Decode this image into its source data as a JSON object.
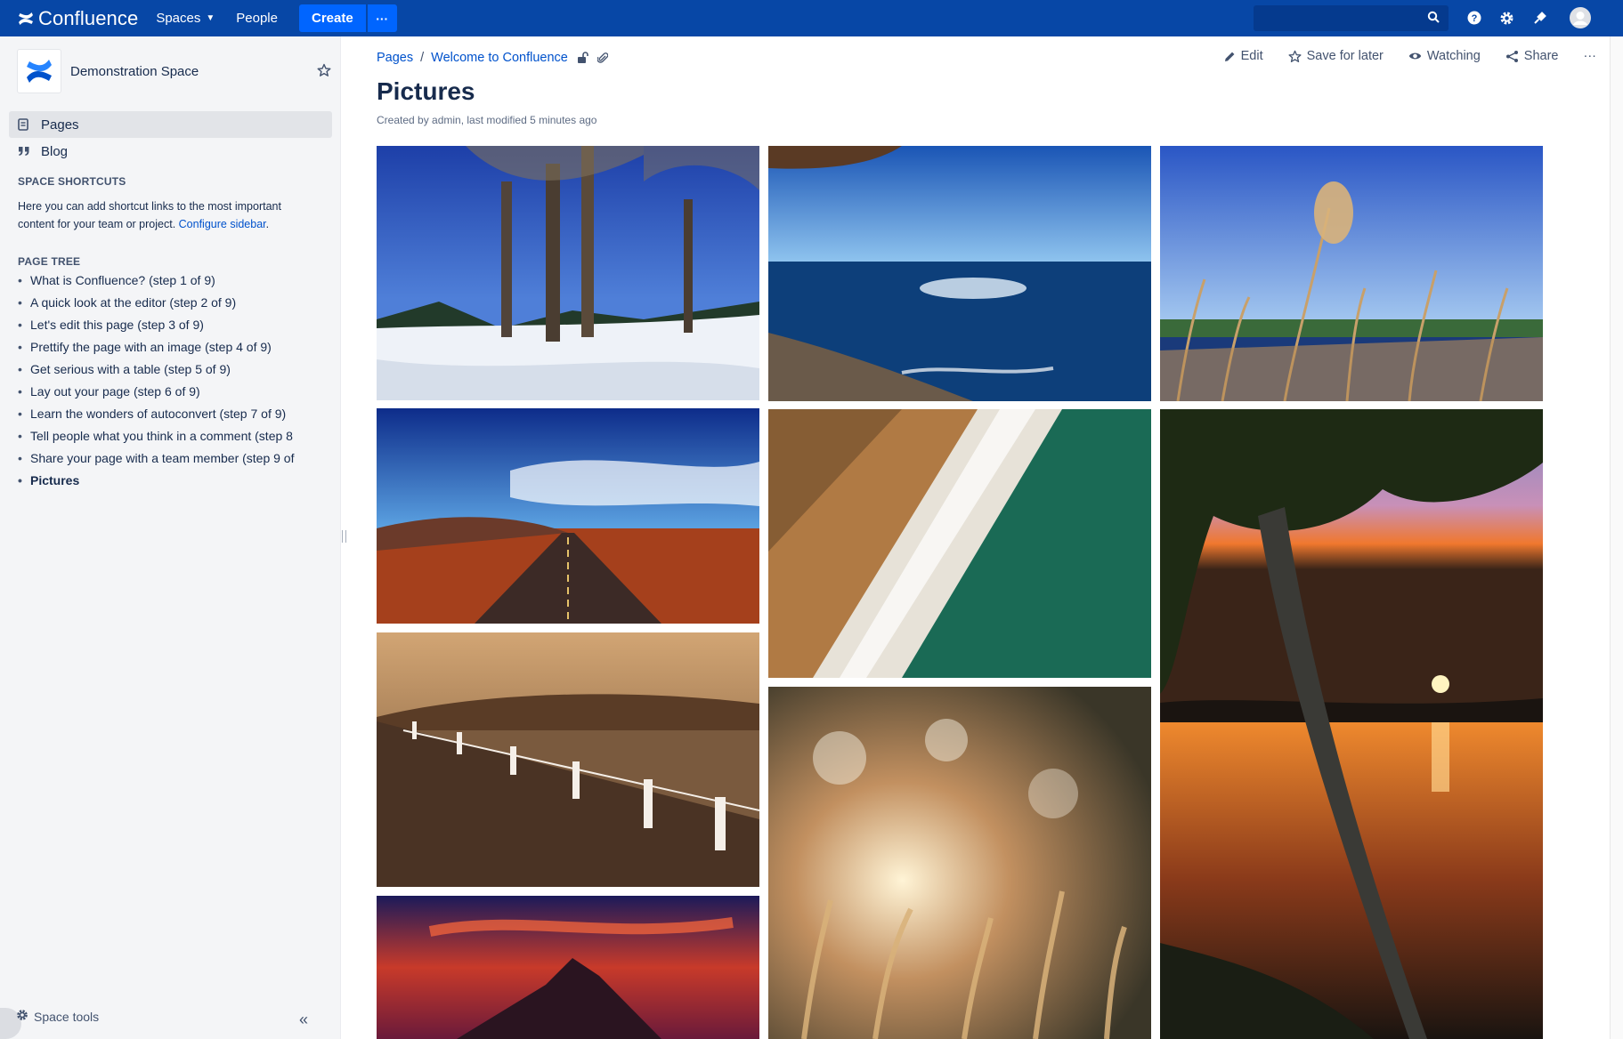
{
  "header": {
    "brand": "Confluence",
    "nav": {
      "spaces": "Spaces",
      "people": "People"
    },
    "create_label": "Create",
    "more_label": "···",
    "search": {
      "placeholder": ""
    },
    "icons": [
      "help-icon",
      "settings-icon",
      "notifications-icon",
      "avatar"
    ]
  },
  "sidebar": {
    "space_name": "Demonstration Space",
    "nav_items": [
      {
        "label": "Pages",
        "icon": "pages-icon",
        "active": true
      },
      {
        "label": "Blog",
        "icon": "quote-icon",
        "active": false
      }
    ],
    "shortcuts_heading": "SPACE SHORTCUTS",
    "shortcuts_text": "Here you can add shortcut links to the most important content for your team or project.",
    "shortcuts_link": "Configure sidebar",
    "shortcuts_end": ".",
    "tree_heading": "PAGE TREE",
    "tree": [
      "What is Confluence? (step 1 of 9)",
      "A quick look at the editor (step 2 of 9)",
      "Let's edit this page (step 3 of 9)",
      "Prettify the page with an image (step 4 of 9)",
      "Get serious with a table (step 5 of 9)",
      "Lay out your page (step 6 of 9)",
      "Learn the wonders of autoconvert (step 7 of 9)",
      "Tell people what you think in a comment (step 8",
      "Share your page with a team member (step 9 of",
      "Pictures"
    ],
    "space_tools": "Space tools"
  },
  "page": {
    "breadcrumb": [
      "Pages",
      "Welcome to Confluence"
    ],
    "breadcrumb_sep": "/",
    "actions": {
      "edit": "Edit",
      "save": "Save for later",
      "watching": "Watching",
      "share": "Share",
      "more": "···"
    },
    "title": "Pictures",
    "byline": "Created by admin, last modified 5 minutes ago"
  },
  "colors": {
    "header": "#0747a6",
    "create": "#0065ff",
    "link": "#0052cc",
    "sidebar": "#f4f5f7"
  }
}
